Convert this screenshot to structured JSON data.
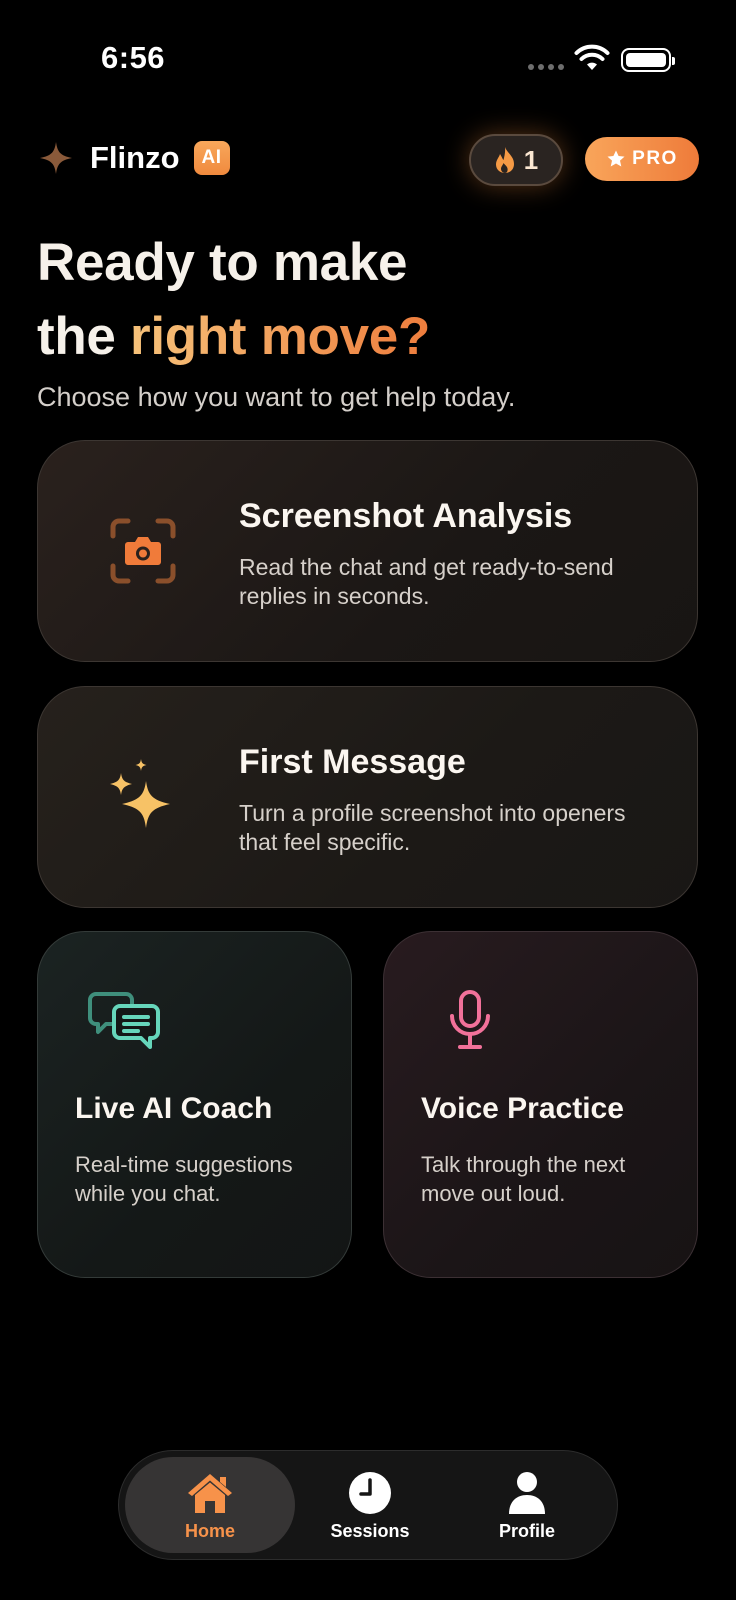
{
  "status_bar": {
    "time": "6:56"
  },
  "header": {
    "brand_name": "Flinzo",
    "ai_badge": "AI",
    "streak_count": "1",
    "pro_label": "PRO"
  },
  "hero": {
    "headline_line1": "Ready to make",
    "headline_line2_prefix": "the ",
    "headline_line2_accent": "right move?",
    "subtitle": "Choose how you want to get help today."
  },
  "cards": [
    {
      "title": "Screenshot Analysis",
      "description": "Read the chat and get ready-to-send replies in seconds.",
      "icon": "camera-scan-icon"
    },
    {
      "title": "First Message",
      "description": "Turn a profile screenshot into openers that feel specific.",
      "icon": "sparkles-icon"
    },
    {
      "title": "Live AI Coach",
      "description": "Real-time suggestions while you chat.",
      "icon": "chat-bubbles-icon"
    },
    {
      "title": "Voice Practice",
      "description": "Talk through the next move out loud.",
      "icon": "microphone-icon"
    }
  ],
  "tabbar": {
    "tabs": [
      {
        "label": "Home",
        "icon": "home-icon",
        "active": true
      },
      {
        "label": "Sessions",
        "icon": "clock-icon",
        "active": false
      },
      {
        "label": "Profile",
        "icon": "person-icon",
        "active": false
      }
    ]
  },
  "colors": {
    "accent_orange": "#f08a3e",
    "accent_gold": "#f6c27a",
    "coach_teal": "#5fd3b8",
    "voice_pink": "#f2719a",
    "background": "#000000"
  }
}
